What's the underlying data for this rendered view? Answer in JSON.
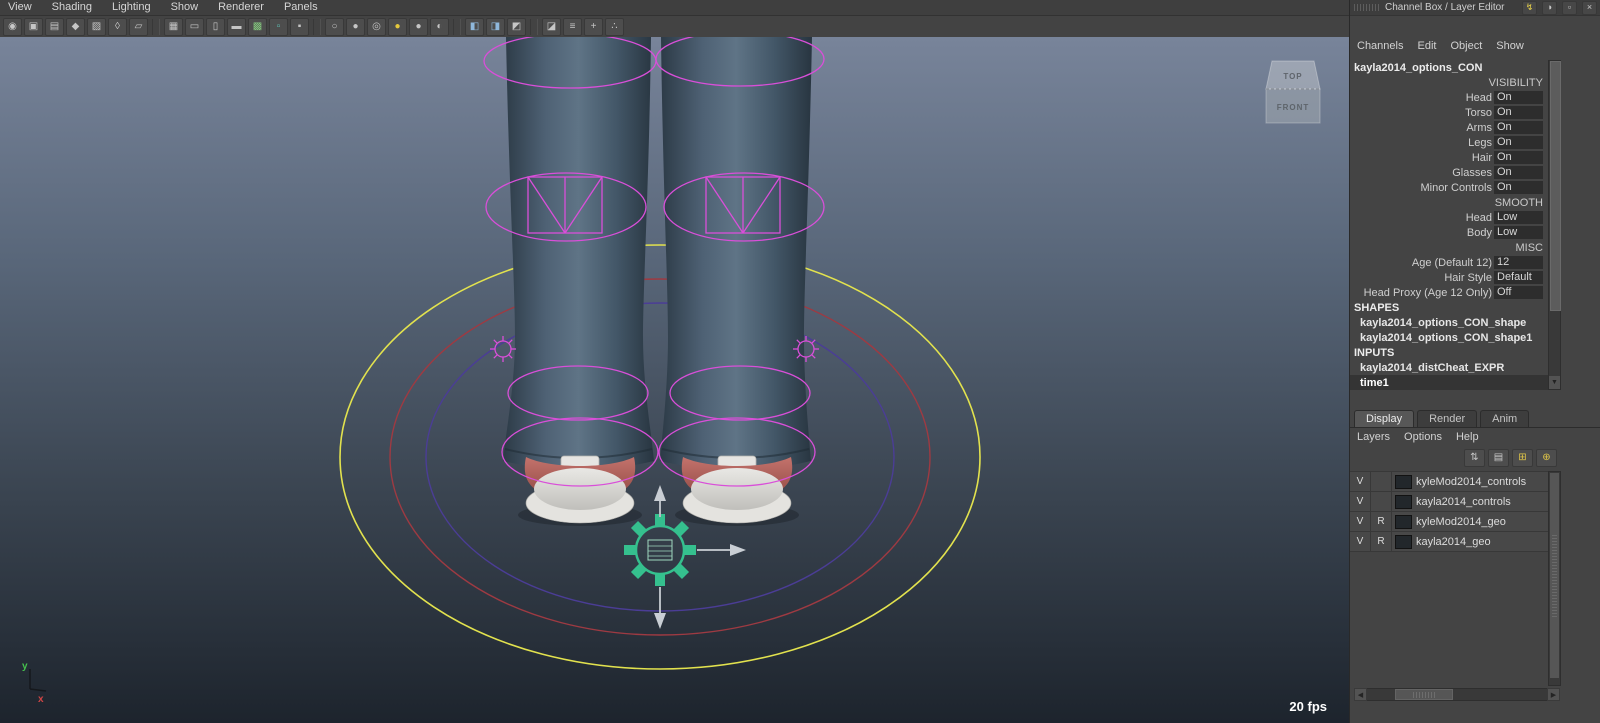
{
  "colors": {
    "control_magenta": "#d94fd9",
    "ring_yellow": "#e2e24e",
    "ring_red": "#9e3a42",
    "ring_purple": "#4b3d96",
    "gear_teal": "#35c08e",
    "jeans_blue": "#55687a",
    "shoe_red": "#b5655f",
    "viewport_top": "#78849a",
    "viewport_bottom": "#1d242d"
  },
  "panel_menu": {
    "items": [
      "View",
      "Shading",
      "Lighting",
      "Show",
      "Renderer",
      "Panels"
    ]
  },
  "toolbar": {
    "icons": [
      {
        "name": "select-camera-icon",
        "glyph": "◉"
      },
      {
        "name": "lock-camera-icon",
        "glyph": "▣"
      },
      {
        "name": "camera-attributes-icon",
        "glyph": "▤"
      },
      {
        "name": "bookmarks-icon",
        "glyph": "◆"
      },
      {
        "name": "image-plane-icon",
        "glyph": "▨"
      },
      {
        "name": "pan-zoom-icon",
        "glyph": "◊"
      },
      {
        "name": "grease-pencil-icon",
        "glyph": "▱"
      },
      {
        "name": "grid-icon",
        "glyph": "▦"
      },
      {
        "name": "film-gate-icon",
        "glyph": "▭"
      },
      {
        "name": "resolution-gate-icon",
        "glyph": "▯"
      },
      {
        "name": "gate-mask-icon",
        "glyph": "▬"
      },
      {
        "name": "field-chart-icon",
        "glyph": "▩"
      },
      {
        "name": "safe-action-icon",
        "glyph": "▫"
      },
      {
        "name": "safe-title-icon",
        "glyph": "▪"
      },
      {
        "name": "wireframe-icon",
        "glyph": "○"
      },
      {
        "name": "smooth-shade-icon",
        "glyph": "●"
      },
      {
        "name": "textured-icon",
        "glyph": "◎"
      },
      {
        "name": "default-lighting-icon",
        "glyph": "●"
      },
      {
        "name": "all-lights-icon",
        "glyph": "●"
      },
      {
        "name": "shadows-icon",
        "glyph": "◐"
      },
      {
        "name": "isolate-select-icon",
        "glyph": "◧"
      },
      {
        "name": "xray-icon",
        "glyph": "◨"
      },
      {
        "name": "joints-xray-icon",
        "glyph": "◩"
      },
      {
        "name": "exposure-icon",
        "glyph": "◪"
      },
      {
        "name": "hud-icon",
        "glyph": "≡"
      },
      {
        "name": "axes-icon",
        "glyph": "+"
      },
      {
        "name": "share-icon",
        "glyph": "∴"
      }
    ]
  },
  "viewport": {
    "fps": "20 fps",
    "viewcube": {
      "top_label": "TOP",
      "front_label": "FRONT"
    },
    "axis": {
      "y": "y",
      "x": "x"
    }
  },
  "channel_box": {
    "title": "Channel Box / Layer Editor",
    "menus": [
      "Channels",
      "Edit",
      "Object",
      "Show"
    ],
    "node_name": "kayla2014_options_CON",
    "rows": [
      {
        "name": "VISIBILITY",
        "value": ""
      },
      {
        "name": "Head",
        "value": "On"
      },
      {
        "name": "Torso",
        "value": "On"
      },
      {
        "name": "Arms",
        "value": "On"
      },
      {
        "name": "Legs",
        "value": "On"
      },
      {
        "name": "Hair",
        "value": "On"
      },
      {
        "name": "Glasses",
        "value": "On"
      },
      {
        "name": "Minor Controls",
        "value": "On"
      },
      {
        "name": "SMOOTH",
        "value": ""
      },
      {
        "name": "Head",
        "value": "Low"
      },
      {
        "name": "Body",
        "value": "Low"
      },
      {
        "name": "MISC",
        "value": ""
      },
      {
        "name": "Age (Default 12)",
        "value": "12"
      },
      {
        "name": "Hair Style",
        "value": "Default"
      },
      {
        "name": "Head Proxy (Age 12 Only)",
        "value": "Off"
      }
    ],
    "shapes_section": {
      "header": "SHAPES",
      "items": [
        "kayla2014_options_CON_shape",
        "kayla2014_options_CON_shape1"
      ]
    },
    "inputs_section": {
      "header": "INPUTS",
      "items": [
        "kayla2014_distCheat_EXPR",
        "time1"
      ]
    }
  },
  "layer_editor": {
    "tabs": [
      "Display",
      "Render",
      "Anim"
    ],
    "active_tab": "Display",
    "menus": [
      "Layers",
      "Options",
      "Help"
    ],
    "layers": [
      {
        "visible": "V",
        "renderable": "",
        "name": "kyleMod2014_controls"
      },
      {
        "visible": "V",
        "renderable": "",
        "name": "kayla2014_controls"
      },
      {
        "visible": "V",
        "renderable": "R",
        "name": "kyleMod2014_geo"
      },
      {
        "visible": "V",
        "renderable": "R",
        "name": "kayla2014_geo"
      }
    ]
  }
}
